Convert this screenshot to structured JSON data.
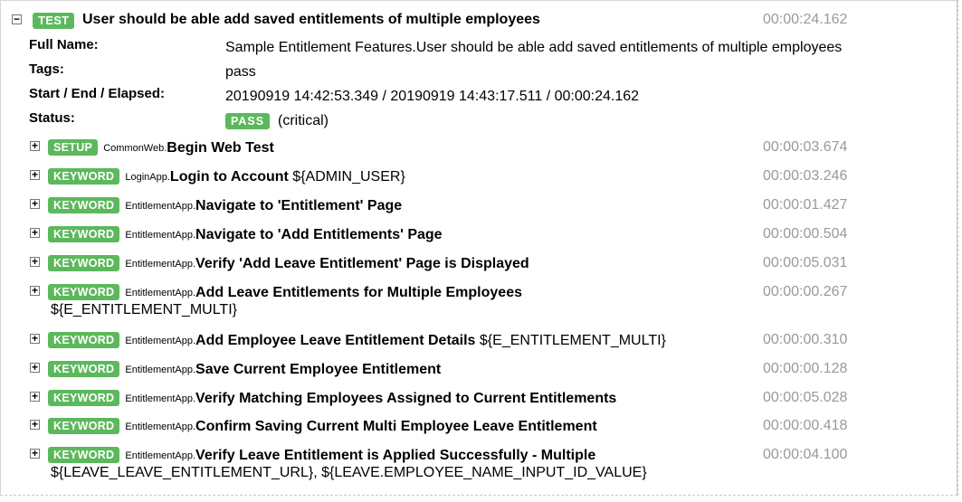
{
  "test": {
    "toggle": "−",
    "badge": "TEST",
    "name": "User should be able add saved entitlements of multiple employees",
    "elapsed": "00:00:24.162",
    "meta": {
      "full_name_label": "Full Name:",
      "full_name": "Sample Entitlement Features.User should be able add saved entitlements of multiple employees",
      "tags_label": "Tags:",
      "tags": "pass",
      "times_label": "Start / End / Elapsed:",
      "times": "20190919 14:42:53.349 / 20190919 14:43:17.511 / 00:00:24.162",
      "status_label": "Status:",
      "status_badge": "PASS",
      "status_note": "(critical)"
    }
  },
  "keywords": [
    {
      "toggle": "+",
      "badge": "SETUP",
      "lib": "CommonWeb.",
      "name": "Begin Web Test",
      "args": "",
      "args_wrap": "",
      "elapsed": "00:00:03.674"
    },
    {
      "toggle": "+",
      "badge": "KEYWORD",
      "lib": "LoginApp.",
      "name": "Login to Account",
      "args": " ${ADMIN_USER}",
      "args_wrap": "",
      "elapsed": "00:00:03.246"
    },
    {
      "toggle": "+",
      "badge": "KEYWORD",
      "lib": "EntitlementApp.",
      "name": "Navigate to 'Entitlement' Page",
      "args": "",
      "args_wrap": "",
      "elapsed": "00:00:01.427"
    },
    {
      "toggle": "+",
      "badge": "KEYWORD",
      "lib": "EntitlementApp.",
      "name": "Navigate to 'Add Entitlements' Page",
      "args": "",
      "args_wrap": "",
      "elapsed": "00:00:00.504"
    },
    {
      "toggle": "+",
      "badge": "KEYWORD",
      "lib": "EntitlementApp.",
      "name": "Verify 'Add Leave Entitlement' Page is Displayed",
      "args": "",
      "args_wrap": "",
      "elapsed": "00:00:05.031"
    },
    {
      "toggle": "+",
      "badge": "KEYWORD",
      "lib": "EntitlementApp.",
      "name": "Add Leave Entitlements for Multiple Employees",
      "args": "",
      "args_wrap": "${E_ENTITLEMENT_MULTI}",
      "elapsed": "00:00:00.267"
    },
    {
      "toggle": "+",
      "badge": "KEYWORD",
      "lib": "EntitlementApp.",
      "name": "Add Employee Leave Entitlement Details",
      "args": " ${E_ENTITLEMENT_MULTI}",
      "args_wrap": "",
      "elapsed": "00:00:00.310"
    },
    {
      "toggle": "+",
      "badge": "KEYWORD",
      "lib": "EntitlementApp.",
      "name": "Save Current Employee Entitlement",
      "args": "",
      "args_wrap": "",
      "elapsed": "00:00:00.128"
    },
    {
      "toggle": "+",
      "badge": "KEYWORD",
      "lib": "EntitlementApp.",
      "name": "Verify Matching Employees Assigned to Current Entitlements",
      "args": "",
      "args_wrap": "",
      "elapsed": "00:00:05.028"
    },
    {
      "toggle": "+",
      "badge": "KEYWORD",
      "lib": "EntitlementApp.",
      "name": "Confirm Saving Current Multi Employee Leave Entitlement",
      "args": "",
      "args_wrap": "",
      "elapsed": "00:00:00.418"
    },
    {
      "toggle": "+",
      "badge": "KEYWORD",
      "lib": "EntitlementApp.",
      "name": "Verify Leave Entitlement is Applied Successfully - Multiple",
      "args": "",
      "args_wrap": "${LEAVE_LEAVE_ENTITLEMENT_URL}, ${LEAVE.EMPLOYEE_NAME_INPUT_ID_VALUE}",
      "elapsed": "00:00:04.100"
    }
  ]
}
